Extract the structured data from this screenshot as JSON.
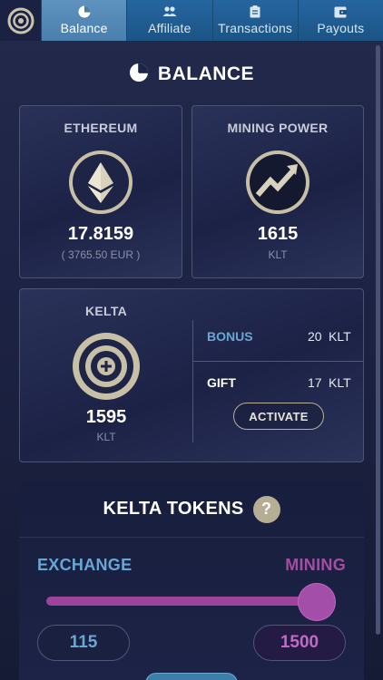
{
  "tabs": [
    {
      "label": "Balance",
      "icon": "pie-chart-icon",
      "active": true
    },
    {
      "label": "Affiliate",
      "icon": "people-icon",
      "active": false
    },
    {
      "label": "Transactions",
      "icon": "clipboard-icon",
      "active": false
    },
    {
      "label": "Payouts",
      "icon": "wallet-icon",
      "active": false
    }
  ],
  "heading": {
    "title": "BALANCE",
    "icon": "pie-chart-icon"
  },
  "ethereum": {
    "title": "ETHEREUM",
    "value": "17.8159",
    "sub": "( 3765.50 EUR )",
    "icon": "ethereum-icon"
  },
  "mining_power": {
    "title": "MINING POWER",
    "value": "1615",
    "unit": "KLT",
    "icon": "trending-up-icon"
  },
  "kelta": {
    "title": "KELTA",
    "value": "1595",
    "unit": "KLT",
    "icon": "target-plus-icon",
    "bonus_label": "BONUS",
    "bonus_value": "20",
    "bonus_unit": "KLT",
    "gift_label": "GIFT",
    "gift_value": "17",
    "gift_unit": "KLT",
    "activate_label": "ACTIVATE"
  },
  "tokens": {
    "title": "KELTA TOKENS",
    "help": "?",
    "exchange_label": "EXCHANGE",
    "mining_label": "MINING",
    "exchange_value": "115",
    "mining_value": "1500",
    "slider_fraction": 0.93
  },
  "colors": {
    "accent_blue": "#6aa6d4",
    "accent_purple": "#a34ea3",
    "gold": "#b5ae94",
    "tab_bar": "#1e5a86"
  }
}
